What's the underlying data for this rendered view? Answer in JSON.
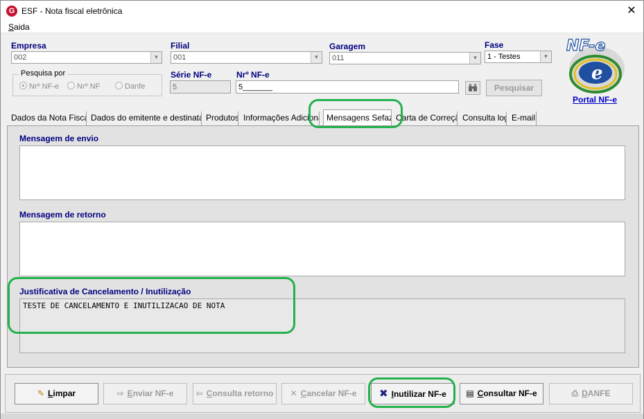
{
  "window": {
    "title": "ESF - Nota fiscal eletrônica",
    "close_glyph": "✕",
    "app_icon_letter": "G"
  },
  "menu": {
    "saida_first": "S",
    "saida_rest": "aida"
  },
  "header": {
    "empresa_label": "Empresa",
    "empresa_value": "002",
    "filial_label": "Filial",
    "filial_value": "001",
    "garagem_label": "Garagem",
    "garagem_value": "011",
    "fase_label": "Fase",
    "fase_value": "1 - Testes",
    "pesquisa_label": "Pesquisa por",
    "radio_nf_e": "Nrº NF-e",
    "radio_nf": "Nrº NF",
    "radio_danfe": "Danfe",
    "serie_label": "Série NF-e",
    "serie_value": "5",
    "nr_label": "Nrº NF-e",
    "nr_value": "5_______",
    "pesquisar_label": "Pesquisar",
    "portal_link": "Portal NF-e",
    "logo_text": "NF-e"
  },
  "tabs": [
    {
      "label": "Dados da Nota Fiscal"
    },
    {
      "label": "Dados do emitente e destinatário"
    },
    {
      "label": "Produtos"
    },
    {
      "label": "Informações Adicionais"
    },
    {
      "label": "Mensagens Sefaz"
    },
    {
      "label": "Carta de Correção"
    },
    {
      "label": "Consulta log"
    },
    {
      "label": "E-mail"
    }
  ],
  "panel": {
    "envio_label": "Mensagem de envio",
    "retorno_label": "Mensagem de retorno",
    "justificativa_label": "Justificativa de Cancelamento / Inutilização",
    "justificativa_value": "TESTE DE CANCELAMENTO E INUTILIZACAO DE NOTA"
  },
  "buttons": {
    "limpar_first": "L",
    "limpar_rest": "impar",
    "enviar_first": "E",
    "enviar_rest": "nviar NF-e",
    "consulta_retorno_first": "C",
    "consulta_retorno_rest": "onsulta retorno",
    "cancelar_first": "C",
    "cancelar_rest": "ancelar NF-e",
    "inutilizar_first": "I",
    "inutilizar_rest": "nutilizar NF-e",
    "consultar_first": "C",
    "consultar_rest": "onsultar NF-e",
    "danfe_first": "D",
    "danfe_rest": "ANFE"
  },
  "colors": {
    "label_navy": "#000080",
    "highlight_green": "#22b14c",
    "link_blue": "#0000cc"
  }
}
